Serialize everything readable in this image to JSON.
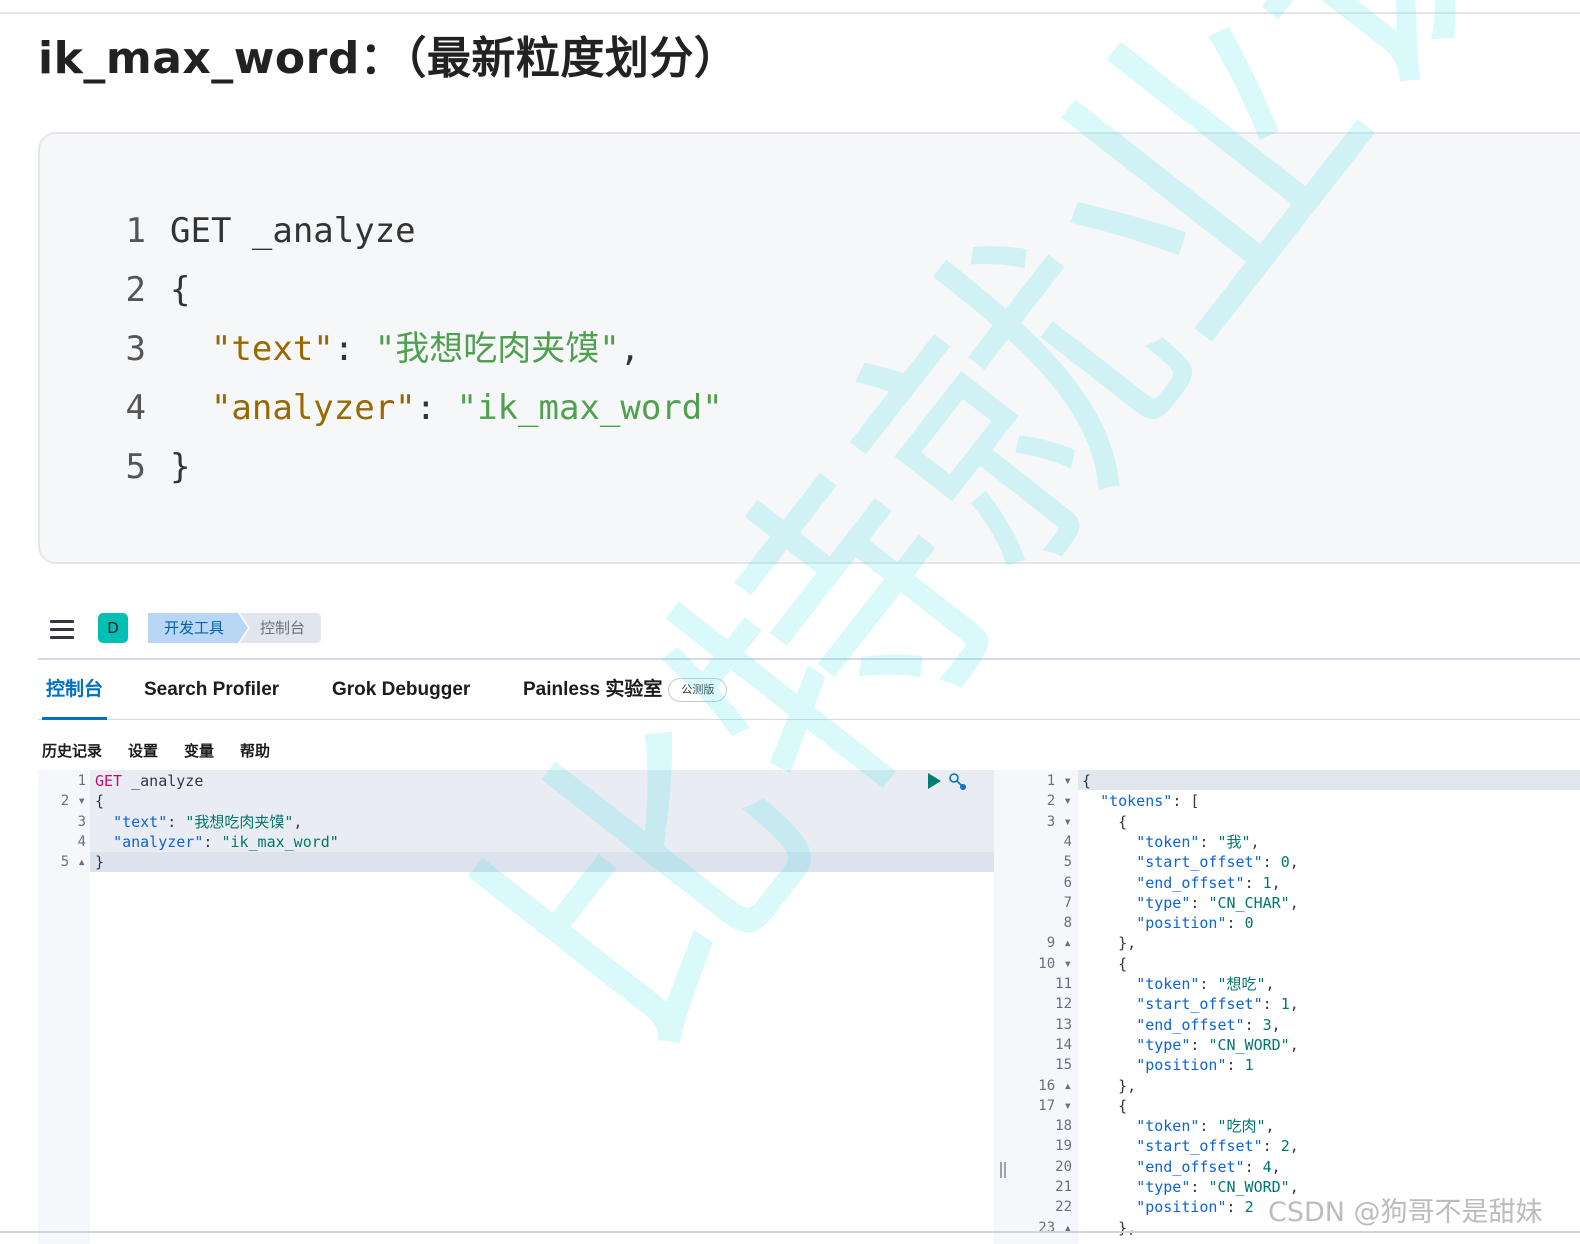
{
  "article": {
    "heading": "ik_max_word：（最新粒度划分）",
    "code_lines": [
      {
        "num": "1",
        "parts": [
          {
            "t": "GET _analyze",
            "c": "p"
          }
        ]
      },
      {
        "num": "2",
        "parts": [
          {
            "t": "{",
            "c": "p"
          }
        ]
      },
      {
        "num": "3",
        "parts": [
          {
            "t": "  ",
            "c": "p"
          },
          {
            "t": "\"text\"",
            "c": "k"
          },
          {
            "t": ": ",
            "c": "p"
          },
          {
            "t": "\"我想吃肉夹馍\"",
            "c": "s"
          },
          {
            "t": ",",
            "c": "p"
          }
        ]
      },
      {
        "num": "4",
        "parts": [
          {
            "t": "  ",
            "c": "p"
          },
          {
            "t": "\"analyzer\"",
            "c": "k"
          },
          {
            "t": ": ",
            "c": "p"
          },
          {
            "t": "\"ik_max_word\"",
            "c": "s"
          }
        ]
      },
      {
        "num": "5",
        "parts": [
          {
            "t": "}",
            "c": "p"
          }
        ]
      }
    ]
  },
  "kibana": {
    "avatar": "D",
    "breadcrumbs": [
      "开发工具",
      "控制台"
    ],
    "tabs": [
      {
        "label": "控制台",
        "active": true
      },
      {
        "label": "Search Profiler",
        "active": false
      },
      {
        "label": "Grok Debugger",
        "active": false
      },
      {
        "label": "Painless 实验室",
        "active": false,
        "badge": "公测版"
      }
    ],
    "toolbar": [
      "历史记录",
      "设置",
      "变量",
      "帮助"
    ],
    "request_lines": [
      {
        "num": "1",
        "fold": "",
        "parts": [
          {
            "t": "GET",
            "c": "m"
          },
          {
            "t": " _analyze",
            "c": "jp"
          }
        ]
      },
      {
        "num": "2",
        "fold": "▾",
        "parts": [
          {
            "t": "{",
            "c": "jp"
          }
        ]
      },
      {
        "num": "3",
        "fold": "",
        "parts": [
          {
            "t": "  ",
            "c": "jp"
          },
          {
            "t": "\"text\"",
            "c": "jk"
          },
          {
            "t": ": ",
            "c": "jp"
          },
          {
            "t": "\"我想吃肉夹馍\"",
            "c": "js"
          },
          {
            "t": ",",
            "c": "jp"
          }
        ]
      },
      {
        "num": "4",
        "fold": "",
        "parts": [
          {
            "t": "  ",
            "c": "jp"
          },
          {
            "t": "\"analyzer\"",
            "c": "jk"
          },
          {
            "t": ": ",
            "c": "jp"
          },
          {
            "t": "\"ik_max_word\"",
            "c": "js"
          }
        ]
      },
      {
        "num": "5",
        "fold": "▴",
        "parts": [
          {
            "t": "}",
            "c": "jp"
          }
        ]
      }
    ],
    "response_lines": [
      {
        "num": "1",
        "fold": "▾",
        "parts": [
          {
            "t": "{",
            "c": "jp"
          }
        ]
      },
      {
        "num": "2",
        "fold": "▾",
        "parts": [
          {
            "t": "  ",
            "c": "jp"
          },
          {
            "t": "\"tokens\"",
            "c": "jk"
          },
          {
            "t": ": [",
            "c": "jp"
          }
        ]
      },
      {
        "num": "3",
        "fold": "▾",
        "parts": [
          {
            "t": "    {",
            "c": "jp"
          }
        ]
      },
      {
        "num": "4",
        "fold": "",
        "parts": [
          {
            "t": "      ",
            "c": "jp"
          },
          {
            "t": "\"token\"",
            "c": "jk"
          },
          {
            "t": ": ",
            "c": "jp"
          },
          {
            "t": "\"我\"",
            "c": "js"
          },
          {
            "t": ",",
            "c": "jp"
          }
        ]
      },
      {
        "num": "5",
        "fold": "",
        "parts": [
          {
            "t": "      ",
            "c": "jp"
          },
          {
            "t": "\"start_offset\"",
            "c": "jk"
          },
          {
            "t": ": ",
            "c": "jp"
          },
          {
            "t": "0",
            "c": "jn"
          },
          {
            "t": ",",
            "c": "jp"
          }
        ]
      },
      {
        "num": "6",
        "fold": "",
        "parts": [
          {
            "t": "      ",
            "c": "jp"
          },
          {
            "t": "\"end_offset\"",
            "c": "jk"
          },
          {
            "t": ": ",
            "c": "jp"
          },
          {
            "t": "1",
            "c": "jn"
          },
          {
            "t": ",",
            "c": "jp"
          }
        ]
      },
      {
        "num": "7",
        "fold": "",
        "parts": [
          {
            "t": "      ",
            "c": "jp"
          },
          {
            "t": "\"type\"",
            "c": "jk"
          },
          {
            "t": ": ",
            "c": "jp"
          },
          {
            "t": "\"CN_CHAR\"",
            "c": "js"
          },
          {
            "t": ",",
            "c": "jp"
          }
        ]
      },
      {
        "num": "8",
        "fold": "",
        "parts": [
          {
            "t": "      ",
            "c": "jp"
          },
          {
            "t": "\"position\"",
            "c": "jk"
          },
          {
            "t": ": ",
            "c": "jp"
          },
          {
            "t": "0",
            "c": "jn"
          }
        ]
      },
      {
        "num": "9",
        "fold": "▴",
        "parts": [
          {
            "t": "    },",
            "c": "jp"
          }
        ]
      },
      {
        "num": "10",
        "fold": "▾",
        "parts": [
          {
            "t": "    {",
            "c": "jp"
          }
        ]
      },
      {
        "num": "11",
        "fold": "",
        "parts": [
          {
            "t": "      ",
            "c": "jp"
          },
          {
            "t": "\"token\"",
            "c": "jk"
          },
          {
            "t": ": ",
            "c": "jp"
          },
          {
            "t": "\"想吃\"",
            "c": "js"
          },
          {
            "t": ",",
            "c": "jp"
          }
        ]
      },
      {
        "num": "12",
        "fold": "",
        "parts": [
          {
            "t": "      ",
            "c": "jp"
          },
          {
            "t": "\"start_offset\"",
            "c": "jk"
          },
          {
            "t": ": ",
            "c": "jp"
          },
          {
            "t": "1",
            "c": "jn"
          },
          {
            "t": ",",
            "c": "jp"
          }
        ]
      },
      {
        "num": "13",
        "fold": "",
        "parts": [
          {
            "t": "      ",
            "c": "jp"
          },
          {
            "t": "\"end_offset\"",
            "c": "jk"
          },
          {
            "t": ": ",
            "c": "jp"
          },
          {
            "t": "3",
            "c": "jn"
          },
          {
            "t": ",",
            "c": "jp"
          }
        ]
      },
      {
        "num": "14",
        "fold": "",
        "parts": [
          {
            "t": "      ",
            "c": "jp"
          },
          {
            "t": "\"type\"",
            "c": "jk"
          },
          {
            "t": ": ",
            "c": "jp"
          },
          {
            "t": "\"CN_WORD\"",
            "c": "js"
          },
          {
            "t": ",",
            "c": "jp"
          }
        ]
      },
      {
        "num": "15",
        "fold": "",
        "parts": [
          {
            "t": "      ",
            "c": "jp"
          },
          {
            "t": "\"position\"",
            "c": "jk"
          },
          {
            "t": ": ",
            "c": "jp"
          },
          {
            "t": "1",
            "c": "jn"
          }
        ]
      },
      {
        "num": "16",
        "fold": "▴",
        "parts": [
          {
            "t": "    },",
            "c": "jp"
          }
        ]
      },
      {
        "num": "17",
        "fold": "▾",
        "parts": [
          {
            "t": "    {",
            "c": "jp"
          }
        ]
      },
      {
        "num": "18",
        "fold": "",
        "parts": [
          {
            "t": "      ",
            "c": "jp"
          },
          {
            "t": "\"token\"",
            "c": "jk"
          },
          {
            "t": ": ",
            "c": "jp"
          },
          {
            "t": "\"吃肉\"",
            "c": "js"
          },
          {
            "t": ",",
            "c": "jp"
          }
        ]
      },
      {
        "num": "19",
        "fold": "",
        "parts": [
          {
            "t": "      ",
            "c": "jp"
          },
          {
            "t": "\"start_offset\"",
            "c": "jk"
          },
          {
            "t": ": ",
            "c": "jp"
          },
          {
            "t": "2",
            "c": "jn"
          },
          {
            "t": ",",
            "c": "jp"
          }
        ]
      },
      {
        "num": "20",
        "fold": "",
        "parts": [
          {
            "t": "      ",
            "c": "jp"
          },
          {
            "t": "\"end_offset\"",
            "c": "jk"
          },
          {
            "t": ": ",
            "c": "jp"
          },
          {
            "t": "4",
            "c": "jn"
          },
          {
            "t": ",",
            "c": "jp"
          }
        ]
      },
      {
        "num": "21",
        "fold": "",
        "parts": [
          {
            "t": "      ",
            "c": "jp"
          },
          {
            "t": "\"type\"",
            "c": "jk"
          },
          {
            "t": ": ",
            "c": "jp"
          },
          {
            "t": "\"CN_WORD\"",
            "c": "js"
          },
          {
            "t": ",",
            "c": "jp"
          }
        ]
      },
      {
        "num": "22",
        "fold": "",
        "parts": [
          {
            "t": "      ",
            "c": "jp"
          },
          {
            "t": "\"position\"",
            "c": "jk"
          },
          {
            "t": ": ",
            "c": "jp"
          },
          {
            "t": "2",
            "c": "jn"
          }
        ]
      },
      {
        "num": "23",
        "fold": "▴",
        "parts": [
          {
            "t": "    },",
            "c": "jp"
          }
        ]
      }
    ]
  },
  "watermarks": {
    "diagonal": "比特就业课",
    "csdn": "CSDN @狗哥不是甜妹"
  },
  "colors": {
    "accent": "#0071c2",
    "avatar": "#00bfb3",
    "watermark": "#40e0eb"
  }
}
